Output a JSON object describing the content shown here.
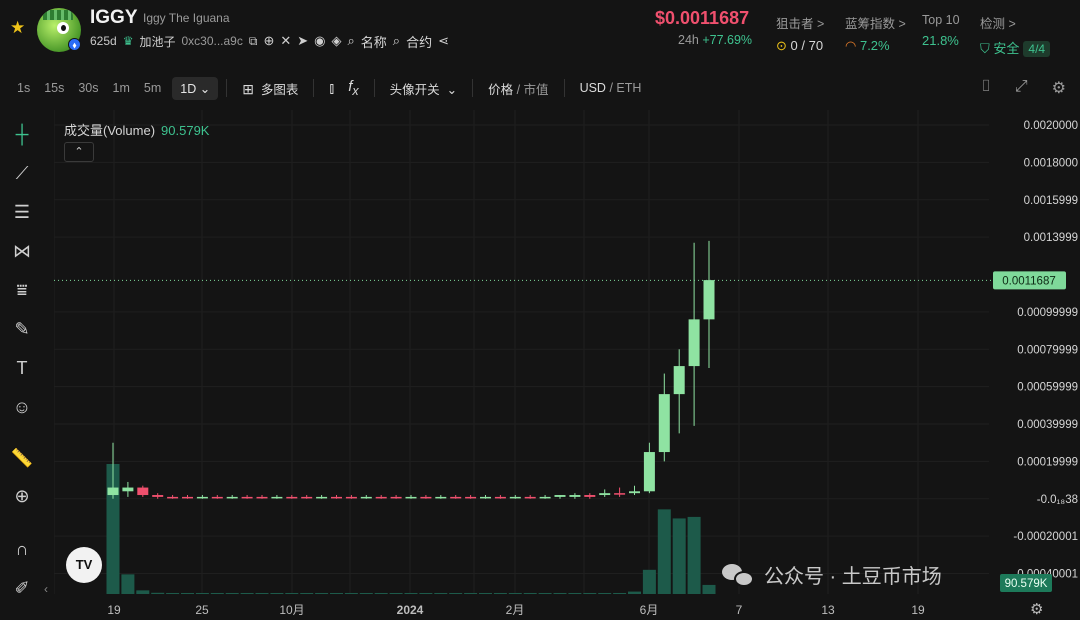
{
  "header": {
    "symbol": "IGGY",
    "name": "Iggy The Iguana",
    "age": "625d",
    "pool_label": "加池子",
    "address": "0xc30...a9c",
    "name_label": "名称",
    "contract_label": "合约",
    "price": "$0.0011687",
    "change_label": "24h",
    "change": "+77.69%",
    "stats": [
      {
        "label": "狙击者 >",
        "value": "0 / 70"
      },
      {
        "label": "蓝筹指数 >",
        "value": "7.2%"
      },
      {
        "label": "Top 10",
        "value": "21.8%"
      },
      {
        "label": "检测 >",
        "value": "安全",
        "badge": "4/4"
      }
    ]
  },
  "toolbar": {
    "intervals": [
      "1s",
      "15s",
      "30s",
      "1m",
      "5m"
    ],
    "active_interval": "1D",
    "multi_chart": "多图表",
    "avatar_toggle": "头像开关",
    "price_label": "价格",
    "mcap_label": "市值",
    "usd_label": "USD",
    "eth_label": "ETH"
  },
  "chart_data": {
    "type": "candlestick",
    "volume_label": "成交量(Volume)",
    "volume_value": "90.579K",
    "current_price_tag": "0.0011687",
    "current_volume_tag": "90.579K",
    "y_ticks": [
      "0.0020000",
      "0.0018000",
      "0.0015999",
      "0.0013999",
      "0.0011687",
      "0.00099999",
      "0.00079999",
      "0.00059999",
      "0.00039999",
      "0.00019999",
      "-0.0₁₈38",
      "-0.00020001",
      "-0.00040001"
    ],
    "x_ticks": [
      "19",
      "25",
      "10月",
      "2024",
      "2月",
      "6月",
      "7",
      "13",
      "19"
    ],
    "ylim": [
      -0.00044,
      0.002
    ],
    "candles": [
      {
        "o": 2e-05,
        "h": 0.0003,
        "l": 0.0,
        "c": 6e-05,
        "dir": "up"
      },
      {
        "o": 4e-05,
        "h": 9e-05,
        "l": 1e-05,
        "c": 6e-05,
        "dir": "up"
      },
      {
        "o": 6e-05,
        "h": 7e-05,
        "l": 1e-05,
        "c": 2e-05,
        "dir": "down"
      },
      {
        "o": 2e-05,
        "h": 3e-05,
        "l": 0.0,
        "c": 1e-05,
        "dir": "down"
      },
      {
        "o": 1e-05,
        "h": 2e-05,
        "l": 0.0,
        "c": 1e-05,
        "dir": "down"
      },
      {
        "o": 1e-05,
        "h": 2e-05,
        "l": 0.0,
        "c": 1e-05,
        "dir": "down"
      },
      {
        "o": 1e-05,
        "h": 2e-05,
        "l": 0.0,
        "c": 1e-05,
        "dir": "up"
      },
      {
        "o": 1e-05,
        "h": 2e-05,
        "l": 0.0,
        "c": 1e-05,
        "dir": "down"
      },
      {
        "o": 1e-05,
        "h": 2e-05,
        "l": 0.0,
        "c": 1e-05,
        "dir": "up"
      },
      {
        "o": 1e-05,
        "h": 2e-05,
        "l": 0.0,
        "c": 1e-05,
        "dir": "down"
      },
      {
        "o": 1e-05,
        "h": 2e-05,
        "l": 0.0,
        "c": 1e-05,
        "dir": "down"
      },
      {
        "o": 1e-05,
        "h": 2e-05,
        "l": 0.0,
        "c": 1e-05,
        "dir": "up"
      },
      {
        "o": 1e-05,
        "h": 2e-05,
        "l": 0.0,
        "c": 1e-05,
        "dir": "down"
      },
      {
        "o": 1e-05,
        "h": 2e-05,
        "l": 0.0,
        "c": 1e-05,
        "dir": "down"
      },
      {
        "o": 1e-05,
        "h": 2e-05,
        "l": 0.0,
        "c": 1e-05,
        "dir": "up"
      },
      {
        "o": 1e-05,
        "h": 2e-05,
        "l": 0.0,
        "c": 1e-05,
        "dir": "down"
      },
      {
        "o": 1e-05,
        "h": 2e-05,
        "l": 0.0,
        "c": 1e-05,
        "dir": "down"
      },
      {
        "o": 1e-05,
        "h": 2e-05,
        "l": 0.0,
        "c": 1e-05,
        "dir": "up"
      },
      {
        "o": 1e-05,
        "h": 2e-05,
        "l": 0.0,
        "c": 1e-05,
        "dir": "down"
      },
      {
        "o": 1e-05,
        "h": 2e-05,
        "l": 0.0,
        "c": 1e-05,
        "dir": "down"
      },
      {
        "o": 1e-05,
        "h": 2e-05,
        "l": 0.0,
        "c": 1e-05,
        "dir": "up"
      },
      {
        "o": 1e-05,
        "h": 2e-05,
        "l": 0.0,
        "c": 1e-05,
        "dir": "down"
      },
      {
        "o": 1e-05,
        "h": 2e-05,
        "l": 0.0,
        "c": 1e-05,
        "dir": "up"
      },
      {
        "o": 1e-05,
        "h": 2e-05,
        "l": 0.0,
        "c": 1e-05,
        "dir": "down"
      },
      {
        "o": 1e-05,
        "h": 2e-05,
        "l": 0.0,
        "c": 1e-05,
        "dir": "down"
      },
      {
        "o": 1e-05,
        "h": 2e-05,
        "l": 0.0,
        "c": 1e-05,
        "dir": "up"
      },
      {
        "o": 1e-05,
        "h": 2e-05,
        "l": 0.0,
        "c": 1e-05,
        "dir": "down"
      },
      {
        "o": 1e-05,
        "h": 2e-05,
        "l": 0.0,
        "c": 1e-05,
        "dir": "up"
      },
      {
        "o": 1e-05,
        "h": 2e-05,
        "l": 0.0,
        "c": 1e-05,
        "dir": "down"
      },
      {
        "o": 1e-05,
        "h": 2e-05,
        "l": 0.0,
        "c": 1e-05,
        "dir": "up"
      },
      {
        "o": 1e-05,
        "h": 2e-05,
        "l": 0.0,
        "c": 2e-05,
        "dir": "up"
      },
      {
        "o": 1e-05,
        "h": 3e-05,
        "l": 0.0,
        "c": 2e-05,
        "dir": "up"
      },
      {
        "o": 1e-05,
        "h": 3e-05,
        "l": 0.0,
        "c": 2e-05,
        "dir": "down"
      },
      {
        "o": 2e-05,
        "h": 5e-05,
        "l": 1e-05,
        "c": 3e-05,
        "dir": "up"
      },
      {
        "o": 3e-05,
        "h": 6e-05,
        "l": 1e-05,
        "c": 3e-05,
        "dir": "down"
      },
      {
        "o": 3e-05,
        "h": 7e-05,
        "l": 2e-05,
        "c": 4e-05,
        "dir": "up"
      },
      {
        "o": 4e-05,
        "h": 0.0003,
        "l": 3e-05,
        "c": 0.00025,
        "dir": "up"
      },
      {
        "o": 0.00025,
        "h": 0.00067,
        "l": 0.0002,
        "c": 0.00056,
        "dir": "up"
      },
      {
        "o": 0.00056,
        "h": 0.0008,
        "l": 0.00035,
        "c": 0.00071,
        "dir": "up"
      },
      {
        "o": 0.00071,
        "h": 0.00137,
        "l": 0.00039,
        "c": 0.00096,
        "dir": "up"
      },
      {
        "o": 0.00096,
        "h": 0.00138,
        "l": 0.0007,
        "c": 0.00117,
        "dir": "up"
      }
    ],
    "volume": [
      0.43,
      0.065,
      0.012,
      0.004,
      0.003,
      0.003,
      0.003,
      0.003,
      0.003,
      0.003,
      0.003,
      0.003,
      0.003,
      0.003,
      0.003,
      0.003,
      0.003,
      0.003,
      0.003,
      0.003,
      0.003,
      0.003,
      0.003,
      0.003,
      0.003,
      0.003,
      0.003,
      0.003,
      0.003,
      0.003,
      0.003,
      0.003,
      0.003,
      0.003,
      0.003,
      0.008,
      0.08,
      0.28,
      0.25,
      0.255,
      0.03
    ]
  },
  "watermark": "公众号 · 土豆币市场",
  "tv_logo": "TV",
  "colors": {
    "up": "#8fe3a2",
    "down": "#f0506e",
    "volume": "#1d5a4a",
    "accent": "#3ec28f"
  }
}
